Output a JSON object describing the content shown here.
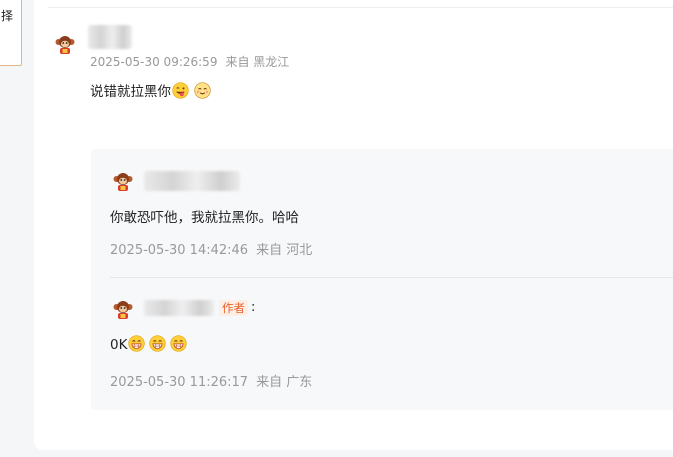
{
  "left_panel": {
    "fragment_text": "择"
  },
  "main_comment": {
    "timestamp": "2025-05-30 09:26:59",
    "location": "来自 黑龙江",
    "text": "说错就拉黑你"
  },
  "replies": [
    {
      "text": "你敢恐吓他，我就拉黑你。哈哈",
      "timestamp": "2025-05-30 14:42:46",
      "location": "来自 河北"
    },
    {
      "author_badge": "作者",
      "colon": ":",
      "text": "0K",
      "timestamp": "2025-05-30 11:26:17",
      "location": "来自 广东"
    }
  ],
  "icons": {
    "avatar": "monkey-avatar-icon",
    "emoji_1": "tongue-wink-emoji-icon",
    "emoji_2": "smile-emoji-icon",
    "emoji_3": "grin-emoji-icon"
  },
  "colors": {
    "page_bg": "#f5f6f8",
    "panel_bg": "#ffffff",
    "reply_bg": "#f7f8fa",
    "meta_text": "#999999",
    "author_badge_text": "#e8612c",
    "author_badge_bg": "#fdeee6"
  }
}
